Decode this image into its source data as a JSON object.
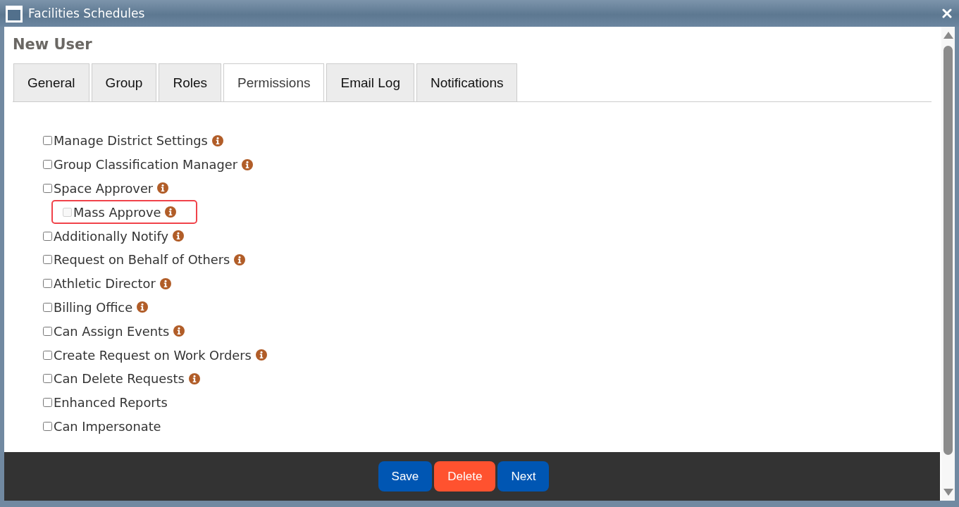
{
  "window": {
    "title": "Facilities Schedules"
  },
  "heading": "New User",
  "tabs": [
    {
      "label": "General",
      "selected": false
    },
    {
      "label": "Group",
      "selected": false
    },
    {
      "label": "Roles",
      "selected": false
    },
    {
      "label": "Permissions",
      "selected": true
    },
    {
      "label": "Email Log",
      "selected": false
    },
    {
      "label": "Notifications",
      "selected": false
    }
  ],
  "permissions": [
    {
      "label": "Manage District Settings",
      "checked": false,
      "disabled": false,
      "info": true,
      "highlighted": false
    },
    {
      "label": "Group Classification Manager",
      "checked": false,
      "disabled": false,
      "info": true,
      "highlighted": false
    },
    {
      "label": "Space Approver",
      "checked": false,
      "disabled": false,
      "info": true,
      "highlighted": false,
      "children": [
        {
          "label": "Mass Approve",
          "checked": false,
          "disabled": true,
          "info": true,
          "highlighted": true
        }
      ]
    },
    {
      "label": "Additionally Notify",
      "checked": false,
      "disabled": false,
      "info": true,
      "highlighted": false
    },
    {
      "label": "Request on Behalf of Others",
      "checked": false,
      "disabled": false,
      "info": true,
      "highlighted": false
    },
    {
      "label": "Athletic Director",
      "checked": false,
      "disabled": false,
      "info": true,
      "highlighted": false
    },
    {
      "label": "Billing Office",
      "checked": false,
      "disabled": false,
      "info": true,
      "highlighted": false
    },
    {
      "label": "Can Assign Events",
      "checked": false,
      "disabled": false,
      "info": true,
      "highlighted": false
    },
    {
      "label": "Create Request on Work Orders",
      "checked": false,
      "disabled": false,
      "info": true,
      "highlighted": false
    },
    {
      "label": "Can Delete Requests",
      "checked": false,
      "disabled": false,
      "info": true,
      "highlighted": false
    },
    {
      "label": "Enhanced Reports",
      "checked": false,
      "disabled": false,
      "info": false,
      "highlighted": false
    },
    {
      "label": "Can Impersonate",
      "checked": false,
      "disabled": false,
      "info": false,
      "highlighted": false
    }
  ],
  "buttons": [
    {
      "label": "Save",
      "kind": "primary"
    },
    {
      "label": "Delete",
      "kind": "danger"
    },
    {
      "label": "Next",
      "kind": "primary"
    }
  ]
}
